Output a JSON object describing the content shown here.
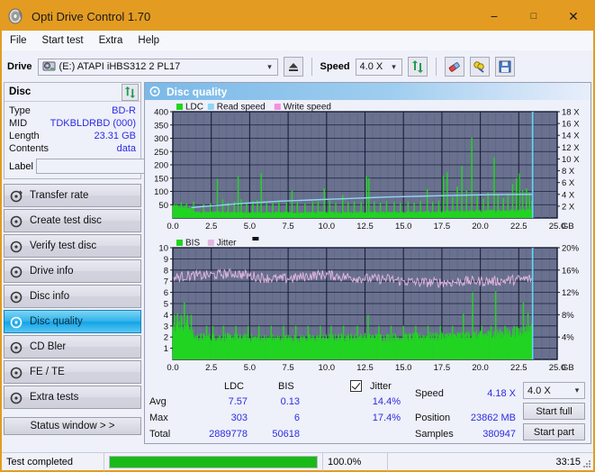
{
  "window": {
    "title": "Opti Drive Control 1.70",
    "minimize": "−",
    "maximize": "□",
    "close": "✕"
  },
  "menu": [
    "File",
    "Start test",
    "Extra",
    "Help"
  ],
  "toolbar": {
    "drive_label": "Drive",
    "drive_value": "(E:)  ATAPI iHBS312  2 PL17",
    "eject_icon": "eject-icon",
    "speed_label": "Speed",
    "speed_value": "4.0 X",
    "refresh_icon": "refresh-icon",
    "erase_icon": "erase-icon",
    "tools_icon": "tools-icon",
    "save_icon": "save-icon"
  },
  "disc": {
    "header": "Disc",
    "refresh_icon": "refresh-icon",
    "rows": [
      {
        "key": "Type",
        "value": "BD-R"
      },
      {
        "key": "MID",
        "value": "TDKBLDRBD (000)"
      },
      {
        "key": "Length",
        "value": "23.31 GB"
      },
      {
        "key": "Contents",
        "value": "data"
      }
    ],
    "label_key": "Label",
    "label_value": "",
    "label_placeholder": "",
    "disc_icon": "disc-icon"
  },
  "nav": {
    "items": [
      {
        "label": "Transfer rate",
        "active": false
      },
      {
        "label": "Create test disc",
        "active": false
      },
      {
        "label": "Verify test disc",
        "active": false
      },
      {
        "label": "Drive info",
        "active": false
      },
      {
        "label": "Disc info",
        "active": false
      },
      {
        "label": "Disc quality",
        "active": true
      },
      {
        "label": "CD Bler",
        "active": false
      },
      {
        "label": "FE / TE",
        "active": false
      },
      {
        "label": "Extra tests",
        "active": false
      }
    ],
    "status_window": "Status window > >"
  },
  "panel": {
    "title": "Disc quality",
    "icon": "disc-quality-icon"
  },
  "stats": {
    "col_ldc": "LDC",
    "col_bis": "BIS",
    "jitter_label": "Jitter",
    "jitter_checked": true,
    "row_avg": "Avg",
    "row_max": "Max",
    "row_total": "Total",
    "avg_ldc": "7.57",
    "avg_bis": "0.13",
    "avg_jitter": "14.4%",
    "max_ldc": "303",
    "max_bis": "6",
    "max_jitter": "17.4%",
    "total_ldc": "2889778",
    "total_bis": "50618",
    "speed_label": "Speed",
    "speed_value": "4.18 X",
    "position_label": "Position",
    "position_value": "23862 MB",
    "samples_label": "Samples",
    "samples_value": "380947",
    "speed_select": "4.0 X",
    "start_full": "Start full",
    "start_part": "Start part"
  },
  "statusbar": {
    "message": "Test completed",
    "progress_pct": 100.0,
    "progress_text": "100.0%",
    "elapsed": "33:15"
  },
  "colors": {
    "accent_orange": "#e39c21",
    "plot_bg": "#69718f",
    "ldc_green": "#22d422",
    "read_speed_blue": "#8fd6f5",
    "write_speed_pink": "#f58fe0",
    "jitter_pink": "#e3b6e0",
    "value_blue": "#2c2ce0",
    "progress_green": "#18ba18"
  },
  "chart_data": [
    {
      "type": "area",
      "name": "quality-chart-top",
      "title": "",
      "xlabel": "GB",
      "ylabel": "",
      "xlim": [
        0,
        25
      ],
      "xticks": [
        "0.0",
        "2.5",
        "5.0",
        "7.5",
        "10.0",
        "12.5",
        "15.0",
        "17.5",
        "20.0",
        "22.5",
        "25.0"
      ],
      "ylim": [
        0,
        400
      ],
      "yticks": [
        50,
        100,
        150,
        200,
        250,
        300,
        350,
        400
      ],
      "y2lim": [
        0,
        18
      ],
      "y2ticks": [
        "2 X",
        "4 X",
        "6 X",
        "8 X",
        "10 X",
        "12 X",
        "14 X",
        "16 X",
        "18 X"
      ],
      "grid": true,
      "legend": [
        "LDC",
        "Read speed",
        "Write speed"
      ],
      "legend_position": "top-left",
      "data_end_gb": 23.4,
      "series": [
        {
          "name": "LDC",
          "color": "#22d422",
          "kind": "impulse",
          "baseline": [
            [
              0.0,
              45
            ],
            [
              0.3,
              44
            ],
            [
              0.6,
              42
            ],
            [
              1.0,
              40
            ],
            [
              1.4,
              24
            ],
            [
              2.0,
              22
            ],
            [
              3.0,
              22
            ],
            [
              4.0,
              21
            ],
            [
              5.0,
              20
            ],
            [
              6.0,
              20
            ],
            [
              7.0,
              20
            ],
            [
              8.0,
              20
            ],
            [
              9.0,
              20
            ],
            [
              10.0,
              21
            ],
            [
              11.0,
              21
            ],
            [
              12.0,
              21
            ],
            [
              13.0,
              21
            ],
            [
              14.0,
              21
            ],
            [
              15.0,
              22
            ],
            [
              16.0,
              22
            ],
            [
              17.0,
              23
            ],
            [
              18.0,
              24
            ],
            [
              19.0,
              25
            ],
            [
              20.0,
              26
            ],
            [
              21.0,
              27
            ],
            [
              22.0,
              28
            ],
            [
              23.0,
              30
            ],
            [
              23.4,
              33
            ]
          ],
          "spikes": [
            [
              0.55,
              60
            ],
            [
              0.9,
              55
            ],
            [
              1.35,
              62
            ],
            [
              2.0,
              52
            ],
            [
              2.45,
              56
            ],
            [
              2.9,
              148
            ],
            [
              3.25,
              70
            ],
            [
              3.6,
              58
            ],
            [
              4.0,
              62
            ],
            [
              4.25,
              158
            ],
            [
              4.45,
              70
            ],
            [
              4.8,
              60
            ],
            [
              5.2,
              64
            ],
            [
              5.5,
              68
            ],
            [
              5.75,
              168
            ],
            [
              6.1,
              62
            ],
            [
              6.5,
              58
            ],
            [
              6.9,
              66
            ],
            [
              7.4,
              58
            ],
            [
              7.75,
              104
            ],
            [
              8.1,
              60
            ],
            [
              8.6,
              56
            ],
            [
              9.1,
              62
            ],
            [
              9.45,
              64
            ],
            [
              9.85,
              112
            ],
            [
              10.2,
              66
            ],
            [
              10.6,
              58
            ],
            [
              11.05,
              86
            ],
            [
              11.4,
              60
            ],
            [
              11.8,
              62
            ],
            [
              12.25,
              60
            ],
            [
              12.6,
              156
            ],
            [
              12.75,
              150
            ],
            [
              13.1,
              62
            ],
            [
              13.5,
              58
            ],
            [
              13.9,
              64
            ],
            [
              14.4,
              60
            ],
            [
              14.8,
              58
            ],
            [
              15.3,
              62
            ],
            [
              15.7,
              58
            ],
            [
              16.1,
              64
            ],
            [
              16.55,
              110
            ],
            [
              16.9,
              62
            ],
            [
              17.3,
              66
            ],
            [
              17.6,
              160
            ],
            [
              17.85,
              172
            ],
            [
              18.2,
              80
            ],
            [
              18.5,
              118
            ],
            [
              18.8,
              196
            ],
            [
              19.1,
              104
            ],
            [
              19.45,
              303
            ],
            [
              19.8,
              88
            ],
            [
              20.2,
              74
            ],
            [
              20.5,
              96
            ],
            [
              20.9,
              228
            ],
            [
              21.15,
              88
            ],
            [
              21.5,
              76
            ],
            [
              21.8,
              92
            ],
            [
              22.1,
              128
            ],
            [
              22.35,
              150
            ],
            [
              22.55,
              168
            ],
            [
              22.75,
              104
            ],
            [
              23.0,
              112
            ],
            [
              23.2,
              96
            ],
            [
              23.35,
              64
            ]
          ]
        },
        {
          "name": "Read speed",
          "color": "#8fd6f5",
          "kind": "line",
          "points": [
            [
              1.2,
              1.75
            ],
            [
              2.0,
              1.95
            ],
            [
              3.0,
              2.15
            ],
            [
              4.0,
              2.35
            ],
            [
              5.0,
              2.55
            ],
            [
              6.0,
              2.7
            ],
            [
              7.0,
              2.85
            ],
            [
              8.0,
              2.95
            ],
            [
              9.0,
              3.05
            ],
            [
              10.0,
              3.15
            ],
            [
              11.0,
              3.25
            ],
            [
              12.0,
              3.35
            ],
            [
              13.0,
              3.45
            ],
            [
              14.0,
              3.55
            ],
            [
              15.0,
              3.62
            ],
            [
              16.0,
              3.68
            ],
            [
              17.0,
              3.74
            ],
            [
              18.0,
              3.8
            ],
            [
              19.0,
              3.86
            ],
            [
              20.0,
              3.92
            ],
            [
              21.0,
              3.96
            ],
            [
              22.0,
              3.98
            ],
            [
              23.0,
              4.0
            ],
            [
              23.4,
              4.0
            ]
          ]
        },
        {
          "name": "Write speed",
          "color": "#f58fe0",
          "kind": "line",
          "points": []
        },
        {
          "name": "end-marker",
          "color": "#5fd8f8",
          "kind": "vline",
          "x": 23.4
        }
      ]
    },
    {
      "type": "area",
      "name": "quality-chart-bottom",
      "title": "",
      "xlabel": "GB",
      "xlim": [
        0,
        25
      ],
      "xticks": [
        "0.0",
        "2.5",
        "5.0",
        "7.5",
        "10.0",
        "12.5",
        "15.0",
        "17.5",
        "20.0",
        "22.5",
        "25.0"
      ],
      "ylim": [
        0,
        10
      ],
      "yticks": [
        1,
        2,
        3,
        4,
        5,
        6,
        7,
        8,
        9,
        10
      ],
      "y2lim": [
        0,
        20
      ],
      "y2ticks": [
        "4%",
        "8%",
        "12%",
        "16%",
        "20%"
      ],
      "grid": true,
      "legend": [
        "BIS",
        "Jitter"
      ],
      "legend_position": "top-left",
      "data_end_gb": 23.4,
      "series": [
        {
          "name": "BIS",
          "color": "#22d422",
          "kind": "impulse",
          "baseline": [
            [
              0.0,
              3.0
            ],
            [
              0.5,
              3.2
            ],
            [
              1.0,
              3.1
            ],
            [
              1.4,
              2.0
            ],
            [
              3.0,
              2.0
            ],
            [
              6.0,
              1.9
            ],
            [
              9.0,
              1.9
            ],
            [
              12.0,
              2.0
            ],
            [
              15.0,
              2.0
            ],
            [
              18.0,
              2.1
            ],
            [
              20.0,
              2.2
            ],
            [
              22.0,
              2.4
            ],
            [
              23.4,
              2.8
            ]
          ],
          "spikes": [
            [
              0.1,
              4.0
            ],
            [
              0.3,
              4.1
            ],
            [
              0.55,
              4.0
            ],
            [
              0.75,
              5.1
            ],
            [
              0.95,
              4.0
            ],
            [
              1.2,
              4.0
            ],
            [
              2.2,
              3.0
            ],
            [
              2.6,
              3.0
            ],
            [
              3.3,
              3.0
            ],
            [
              4.1,
              3.0
            ],
            [
              4.9,
              3.0
            ],
            [
              5.6,
              3.0
            ],
            [
              6.4,
              3.0
            ],
            [
              7.2,
              3.0
            ],
            [
              8.0,
              3.0
            ],
            [
              8.8,
              3.0
            ],
            [
              9.6,
              3.0
            ],
            [
              10.3,
              3.0
            ],
            [
              11.1,
              3.0
            ],
            [
              12.0,
              3.0
            ],
            [
              12.7,
              4.0
            ],
            [
              13.4,
              3.0
            ],
            [
              14.2,
              3.0
            ],
            [
              15.0,
              3.0
            ],
            [
              15.8,
              3.0
            ],
            [
              16.6,
              3.0
            ],
            [
              17.4,
              3.0
            ],
            [
              18.2,
              3.0
            ],
            [
              18.9,
              4.1
            ],
            [
              19.5,
              6.0
            ],
            [
              20.1,
              3.0
            ],
            [
              20.7,
              3.0
            ],
            [
              21.0,
              6.1
            ],
            [
              21.6,
              3.0
            ],
            [
              22.2,
              3.0
            ],
            [
              22.8,
              5.1
            ],
            [
              23.1,
              4.2
            ],
            [
              23.3,
              3.0
            ]
          ]
        },
        {
          "name": "Jitter",
          "color": "#e3b6e0",
          "kind": "noisy-line",
          "mean_points": [
            [
              0.1,
              7.3
            ],
            [
              1.0,
              7.5
            ],
            [
              2.0,
              7.5
            ],
            [
              3.0,
              7.6
            ],
            [
              4.0,
              7.7
            ],
            [
              5.0,
              7.5
            ],
            [
              6.0,
              7.3
            ],
            [
              7.0,
              7.2
            ],
            [
              8.0,
              7.3
            ],
            [
              9.0,
              7.5
            ],
            [
              10.0,
              7.6
            ],
            [
              11.0,
              7.4
            ],
            [
              12.0,
              7.3
            ],
            [
              13.0,
              7.2
            ],
            [
              14.0,
              7.2
            ],
            [
              15.0,
              7.0
            ],
            [
              16.0,
              6.9
            ],
            [
              17.0,
              6.9
            ],
            [
              18.0,
              6.9
            ],
            [
              19.0,
              7.0
            ],
            [
              20.0,
              7.0
            ],
            [
              21.0,
              7.0
            ],
            [
              22.0,
              7.1
            ],
            [
              23.0,
              7.2
            ],
            [
              23.4,
              7.2
            ]
          ],
          "amplitude": 0.45
        },
        {
          "name": "end-marker",
          "color": "#5fd8f8",
          "kind": "vline",
          "x": 23.4
        }
      ]
    }
  ]
}
